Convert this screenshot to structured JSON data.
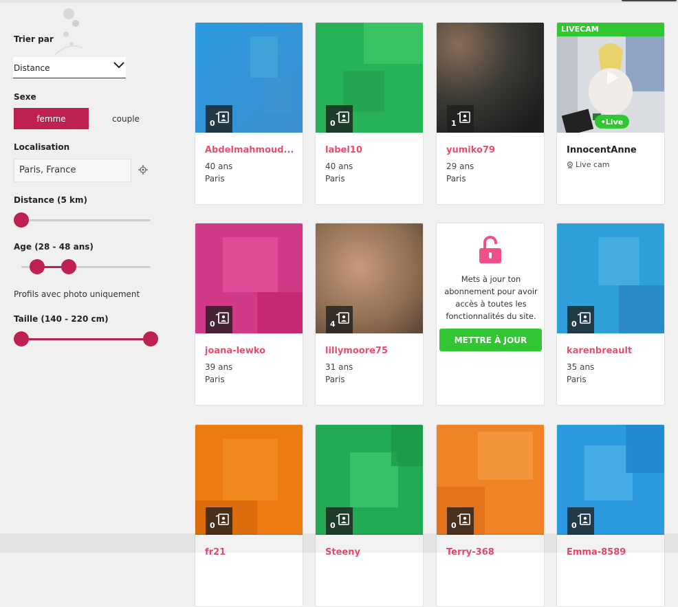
{
  "filters": {
    "sort": {
      "label": "Trier par",
      "value": "Distance"
    },
    "sex": {
      "label": "Sexe",
      "options": [
        "femme",
        "couple"
      ],
      "selected": "femme"
    },
    "location": {
      "label": "Localisation",
      "value": "Paris, France"
    },
    "distance": {
      "label": "Distance (5 km)",
      "value_km": 5
    },
    "age": {
      "label": "Age (28 - 48 ans)",
      "min": 28,
      "max": 48
    },
    "photo_only_label": "Profils avec photo uniquement",
    "height": {
      "label": "Taille (140 - 220 cm)",
      "min": 140,
      "max": 220
    }
  },
  "colors": {
    "accent": "#be2150",
    "link": "#ec4c6c",
    "green": "#33c633"
  },
  "profiles": [
    {
      "name": "Abdelmahmoud...",
      "age": "40 ans",
      "city": "Paris",
      "photos": "0"
    },
    {
      "name": "label10",
      "age": "40 ans",
      "city": "Paris",
      "photos": "0"
    },
    {
      "name": "yumiko79",
      "age": "29 ans",
      "city": "Paris",
      "photos": "1"
    },
    {
      "name": "InnocentAnne",
      "live_badge": "LIVECAM",
      "live_pill": "•Live",
      "live_text": "Live cam"
    },
    {
      "name": "joana-lewko",
      "age": "39 ans",
      "city": "Paris",
      "photos": "0"
    },
    {
      "name": "lillymoore75",
      "age": "31 ans",
      "city": "Paris",
      "photos": "4"
    },
    {
      "upgrade_text": "Mets à jour ton abonnement pour avoir accès à toutes les fonctionnalités du site.",
      "upgrade_button": "METTRE À JOUR"
    },
    {
      "name": "karenbreault",
      "age": "35 ans",
      "city": "Paris",
      "photos": "0"
    },
    {
      "name": "fr21",
      "photos": "0"
    },
    {
      "name": "Steeny",
      "photos": "0"
    },
    {
      "name": "Terry-368",
      "photos": "0"
    },
    {
      "name": "Emma-8589",
      "photos": "0"
    }
  ]
}
